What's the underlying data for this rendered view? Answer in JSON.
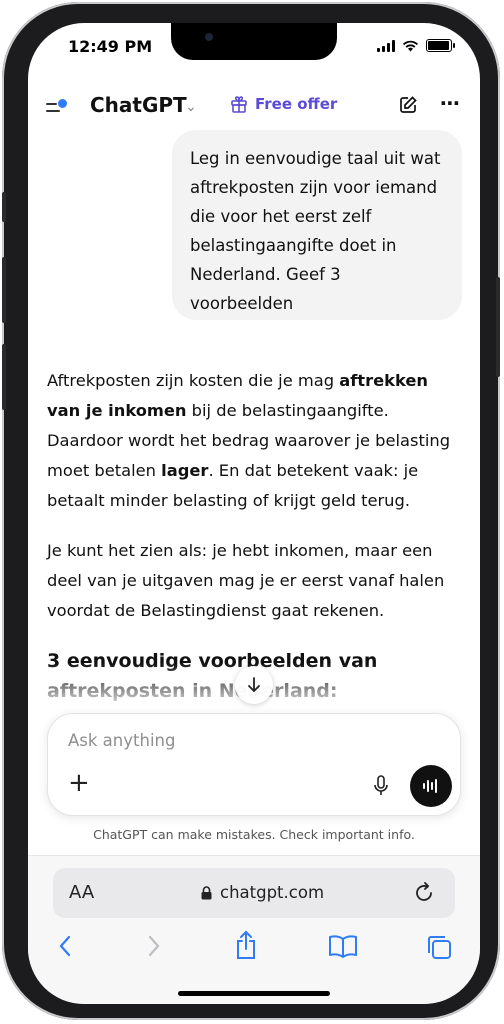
{
  "status_bar": {
    "time": "12:49 PM"
  },
  "header": {
    "title": "ChatGPT",
    "free_offer_label": "Free offer"
  },
  "conversation": {
    "user_message": "Leg in eenvoudige taal uit wat aftrekposten zijn voor iemand die voor het eerst zelf belastingaangifte doet in Nederland. Geef 3 voorbeelden",
    "answer": {
      "p1_a": "Aftrekposten zijn kosten die je mag ",
      "p1_b": "aftrekken van je inkomen",
      "p1_c": " bij de belastingaangifte. Daardoor wordt het bedrag waarover je belasting moet betalen ",
      "p1_d": "lager",
      "p1_e": ". En dat betekent vaak: je betaalt minder belasting of krijgt geld terug.",
      "p2": "Je kunt het zien als: je hebt inkomen, maar een deel van je uitgaven mag je er eerst vanaf halen voordat de Belastingdienst gaat rekenen.",
      "heading": "3 eenvoudige voorbeelden van aftrekposten in Nederland:"
    }
  },
  "composer": {
    "placeholder": "Ask anything",
    "disclaimer": "ChatGPT can make mistakes. Check important info."
  },
  "browser": {
    "aa_label": "AA",
    "url": "chatgpt.com"
  },
  "colors": {
    "accent": "#5b4bd6",
    "menu_dot": "#2f7cf6",
    "safari_blue": "#2f7cf6"
  },
  "icons": [
    "menu-icon",
    "chevron-down-icon",
    "gift-icon",
    "edit-icon",
    "more-icon",
    "arrow-down-icon",
    "plus-icon",
    "mic-icon",
    "voice-wave-icon",
    "lock-icon",
    "reload-icon",
    "back-icon",
    "forward-icon",
    "share-icon",
    "bookmarks-icon",
    "tabs-icon"
  ]
}
